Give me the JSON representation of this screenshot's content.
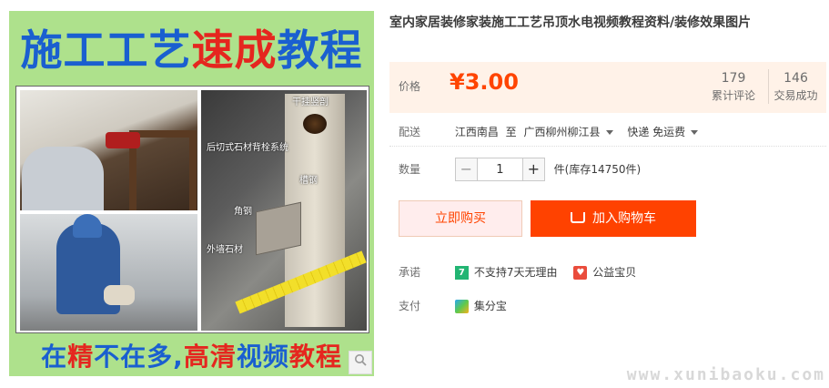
{
  "gallery": {
    "banner_top": {
      "part1": "施工工艺",
      "part2": "速成",
      "part3": "教程"
    },
    "photo_labels": [
      "干挂竖剖",
      "后切式石材背栓系统",
      "槽钢",
      "角钢",
      "外墙石材"
    ],
    "banner_bottom": {
      "p1": "在",
      "p2": "精",
      "p3": "不在多,",
      "p4": "高清",
      "p5": "视频",
      "p6": "教程"
    },
    "zoom_icon": "search-icon"
  },
  "product": {
    "title": "室内家居装修家装施工工艺吊顶水电视频教程资料/装修效果图片",
    "price_label": "价格",
    "price": "¥3.00",
    "reviews_count": "179",
    "reviews_label": "累计评论",
    "sales_count": "146",
    "sales_label": "交易成功"
  },
  "shipping": {
    "label": "配送",
    "from": "江西南昌",
    "to_word": "至",
    "to": "广西柳州柳江县",
    "method": "快递 免运费"
  },
  "quantity": {
    "label": "数量",
    "minus": "−",
    "value": "1",
    "plus": "+",
    "unit": "件(库存14750件)"
  },
  "actions": {
    "buy_now": "立即购买",
    "add_to_cart": "加入购物车"
  },
  "promise": {
    "label": "承诺",
    "item1_badge": "7",
    "item1": "不支持7天无理由",
    "item2": "公益宝贝"
  },
  "payment": {
    "label": "支付",
    "item1": "集分宝"
  },
  "watermark": "www.xunibaoku.com",
  "colors": {
    "price": "#ff4400",
    "cart_button": "#ff4200",
    "price_bg": "#fff2e8",
    "gallery_bg": "#aee18c"
  }
}
